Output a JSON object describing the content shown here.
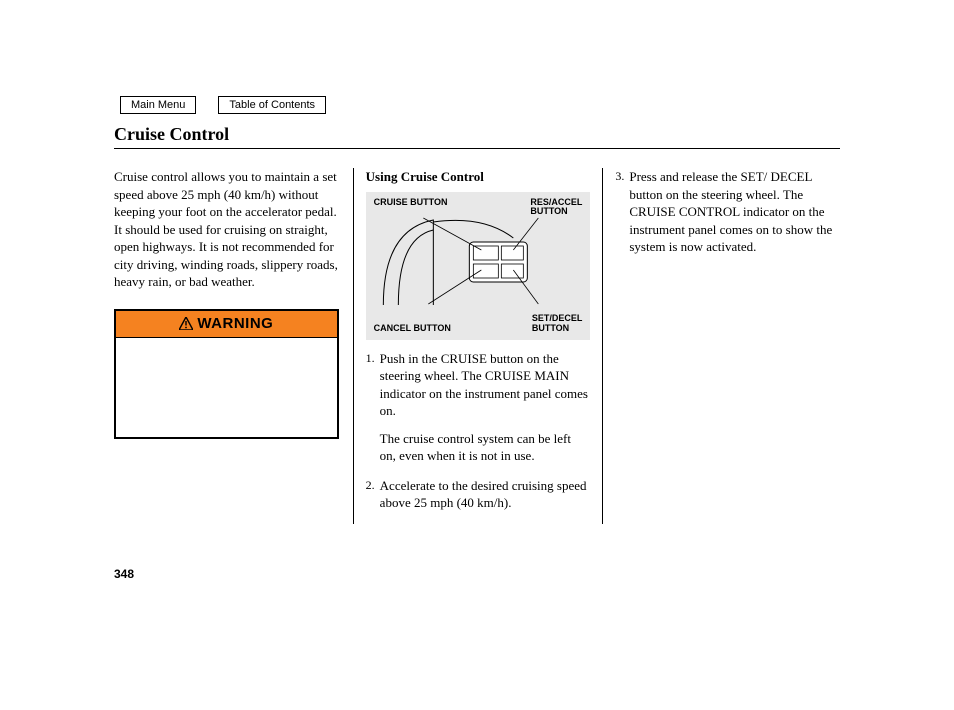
{
  "nav": {
    "main_menu": "Main Menu",
    "toc": "Table of Contents"
  },
  "title": "Cruise Control",
  "col1": {
    "intro": "Cruise control allows you to maintain a set speed above 25 mph (40 km/h) without keeping your foot on the accelerator pedal. It should be used for cruising on straight, open highways. It is not recommended for city driving, winding roads, slippery roads, heavy rain, or bad weather.",
    "warning_label": "WARNING"
  },
  "col2": {
    "heading": "Using Cruise Control",
    "diagram": {
      "tl": "CRUISE BUTTON",
      "tr": "RES/ACCEL BUTTON",
      "bl": "CANCEL BUTTON",
      "br": "SET/DECEL BUTTON"
    },
    "step1_num": "1.",
    "step1": "Push in the CRUISE button on the steering wheel. The CRUISE MAIN indicator on the instrument panel comes on.",
    "step1b": "The cruise control system can be left on, even when it is not in use.",
    "step2_num": "2.",
    "step2": "Accelerate to the desired cruising speed above 25 mph (40 km/h)."
  },
  "col3": {
    "step3_num": "3.",
    "step3": "Press and release the SET/ DECEL button on the steering wheel. The CRUISE CONTROL indicator on the instrument panel comes on to show the system is now activated."
  },
  "page_number": "348"
}
